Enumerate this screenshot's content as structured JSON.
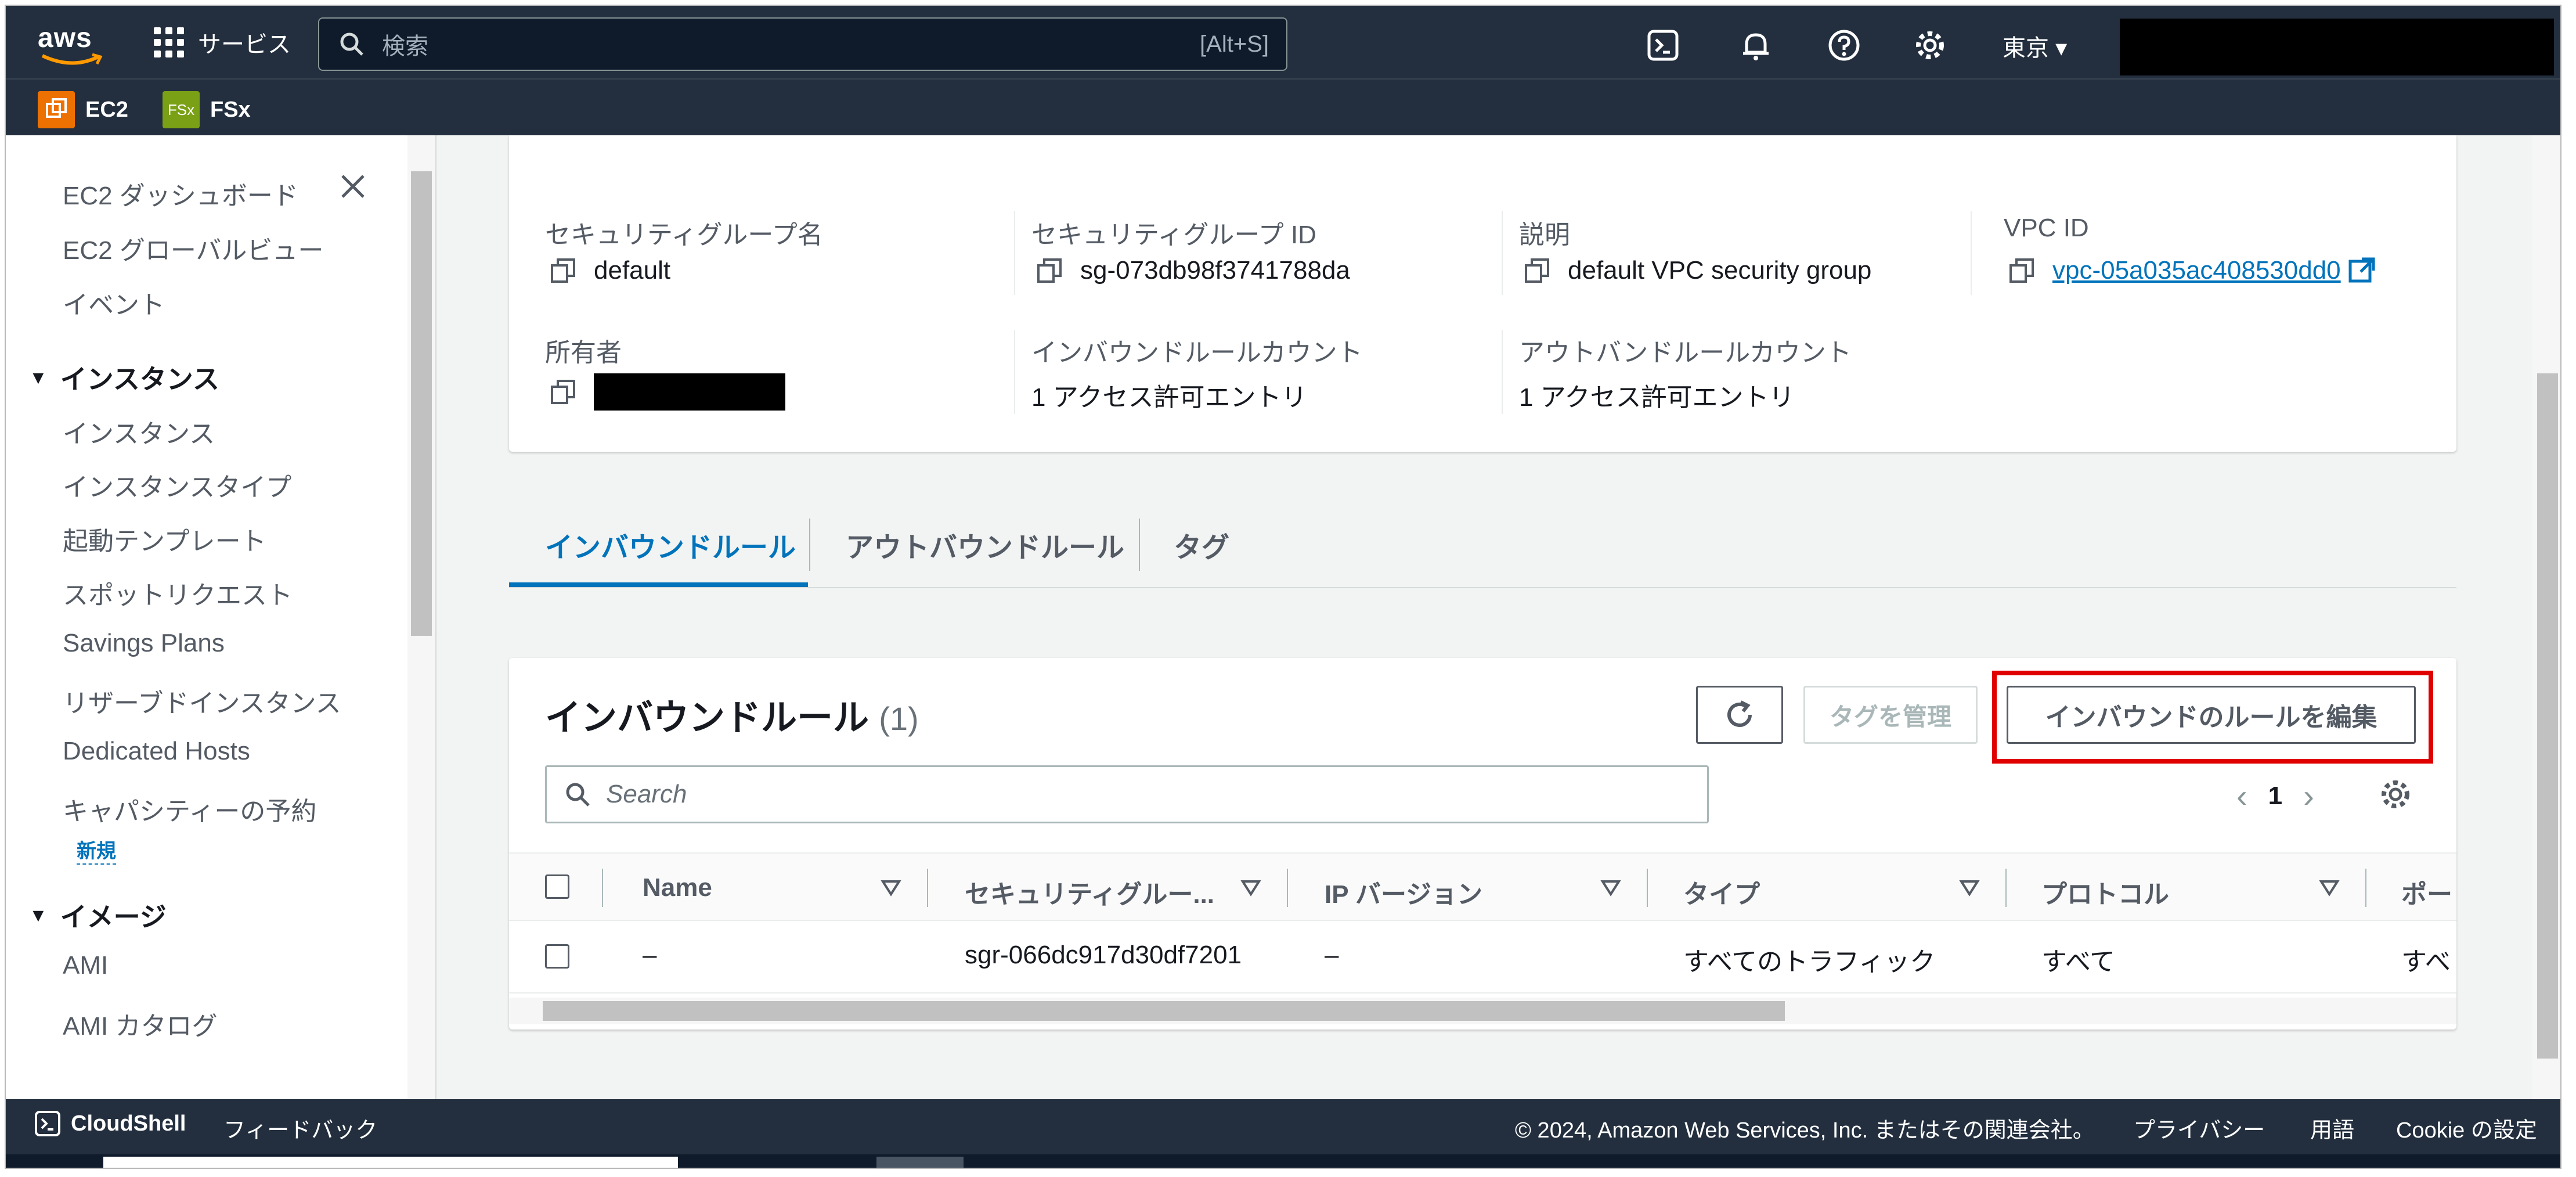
{
  "topnav": {
    "logo_text": "aws",
    "services_label": "サービス",
    "search_placeholder": "検索",
    "search_shortcut": "[Alt+S]",
    "region": "東京 ▾"
  },
  "favorites": [
    {
      "label": "EC2",
      "icon": "ec2-icon",
      "color": "#ed7100"
    },
    {
      "label": "FSx",
      "icon": "fsx-icon",
      "icon_text": "FSx",
      "color": "#7aa116"
    }
  ],
  "sidebar": {
    "items_top": [
      "EC2 ダッシュボード",
      "EC2 グローバルビュー",
      "イベント"
    ],
    "section_instances": "インスタンス",
    "items_instances": [
      "インスタンス",
      "インスタンスタイプ",
      "起動テンプレート",
      "スポットリクエスト",
      "Savings Plans",
      "リザーブドインスタンス",
      "Dedicated Hosts",
      "キャパシティーの予約"
    ],
    "new_badge": "新規",
    "section_images": "イメージ",
    "items_images": [
      "AMI",
      "AMI カタログ"
    ]
  },
  "details": {
    "sg_name_label": "セキュリティグループ名",
    "sg_name": "default",
    "sg_id_label": "セキュリティグループ ID",
    "sg_id": "sg-073db98f3741788da",
    "description_label": "説明",
    "description": "default VPC security group",
    "vpc_label": "VPC ID",
    "vpc_id": "vpc-05a035ac408530dd0",
    "owner_label": "所有者",
    "inbound_count_label": "インバウンドルールカウント",
    "inbound_count": "1 アクセス許可エントリ",
    "outbound_count_label": "アウトバンドルールカウント",
    "outbound_count": "1 アクセス許可エントリ"
  },
  "tabs": [
    {
      "label": "インバウンドルール",
      "active": true
    },
    {
      "label": "アウトバウンドルール",
      "active": false
    },
    {
      "label": "タグ",
      "active": false
    }
  ],
  "rules": {
    "title": "インバウンドルール",
    "count": "(1)",
    "manage_tags": "タグを管理",
    "edit_rules": "インバウンドのルールを編集",
    "search_placeholder": "Search",
    "page": "1",
    "columns": [
      "Name",
      "セキュリティグルー...",
      "IP バージョン",
      "タイプ",
      "プロトコル",
      "ポー"
    ],
    "row": [
      "–",
      "sgr-066dc917d30df7201",
      "–",
      "すべてのトラフィック",
      "すべて",
      "すべ"
    ]
  },
  "footer": {
    "cloudshell": "CloudShell",
    "feedback": "フィードバック",
    "copyright": "© 2024, Amazon Web Services, Inc. またはその関連会社。",
    "privacy": "プライバシー",
    "terms": "用語",
    "cookie": "Cookie の設定"
  },
  "colors": {
    "nav": "#232f3e",
    "link": "#0073bb",
    "highlight": "#e00000"
  }
}
